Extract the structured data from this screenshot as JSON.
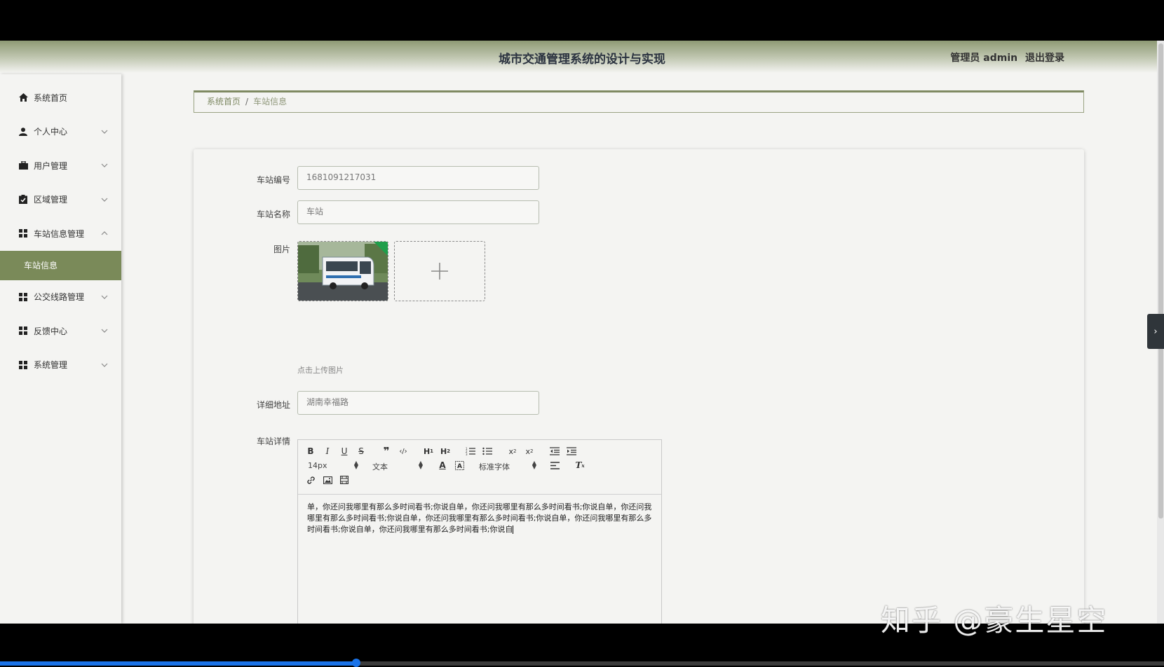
{
  "header": {
    "title": "城市交通管理系统的设计与实现",
    "user_label": "管理员 admin",
    "logout": "退出登录"
  },
  "sidebar": {
    "items": [
      {
        "label": "系统首页",
        "icon": "home-icon"
      },
      {
        "label": "个人中心",
        "icon": "user-icon"
      },
      {
        "label": "用户管理",
        "icon": "briefcase-icon"
      },
      {
        "label": "区域管理",
        "icon": "clipboard-icon"
      },
      {
        "label": "车站信息管理",
        "icon": "grid-icon"
      },
      {
        "label": "公交线路管理",
        "icon": "grid-icon"
      },
      {
        "label": "反馈中心",
        "icon": "grid-icon"
      },
      {
        "label": "系统管理",
        "icon": "grid-icon"
      }
    ],
    "active_sub_item": "车站信息"
  },
  "breadcrumb": {
    "home": "系统首页",
    "separator": "/",
    "current": "车站信息"
  },
  "form": {
    "station_no_label": "车站编号",
    "station_no_value": "1681091217031",
    "station_name_label": "车站名称",
    "station_name_value": "车站",
    "image_label": "图片",
    "upload_hint": "点击上传图片",
    "address_label": "详细地址",
    "address_value": "湖南幸福路",
    "detail_label": "车站详情"
  },
  "editor": {
    "font_size": "14px",
    "block_format": "文本",
    "font_family": "标准字体",
    "content": "单，你还问我哪里有那么多时间看书;你说自单，你还问我哪里有那么多时间看书;你说自单，你还问我哪里有那么多时间看书;你说自单，你还问我哪里有那么多时间看书;你说自单，你还问我哪里有那么多时间看书;你说自单，你还问我哪里有那么多时间看书;你说自"
  },
  "watermark": "知乎 @豪生星空",
  "colors": {
    "accent": "#7a8a59",
    "breadcrumb_link": "#7d8862"
  }
}
